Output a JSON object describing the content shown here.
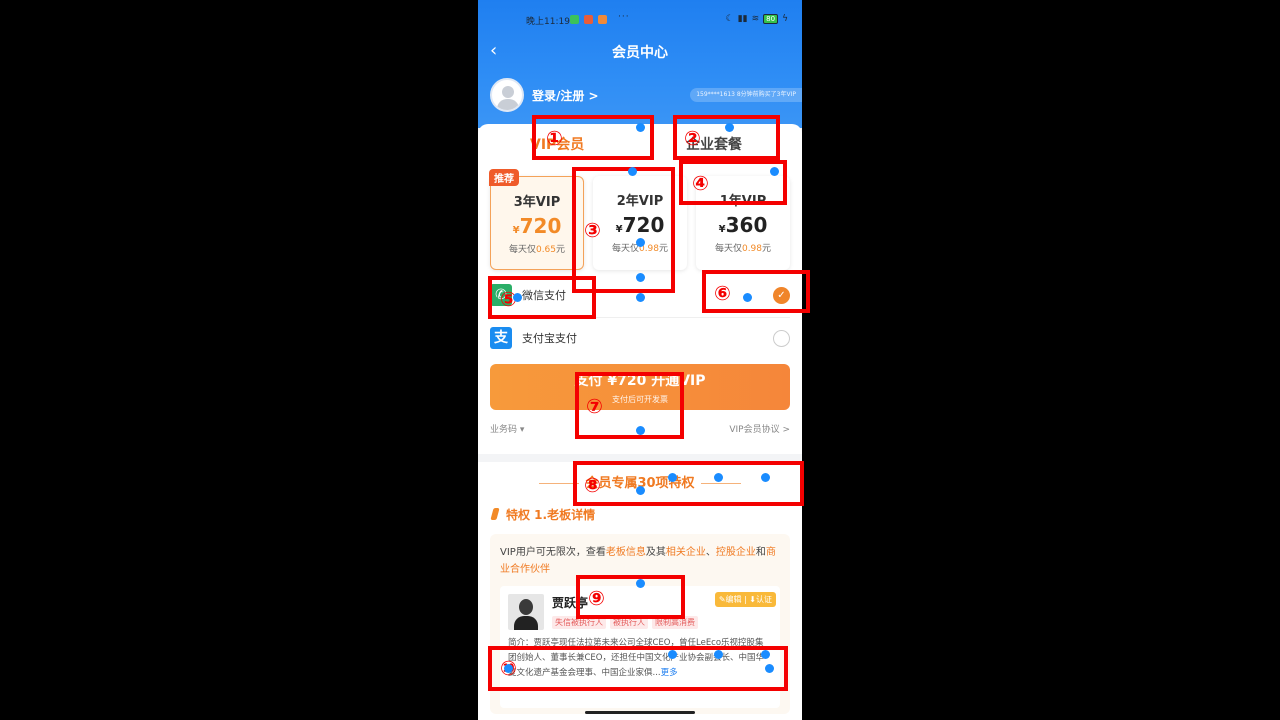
{
  "status_bar": {
    "time": "晚上11:19",
    "dots": "···",
    "battery": "80"
  },
  "nav": {
    "back_icon": "chevron-left-icon",
    "title": "会员中心"
  },
  "user": {
    "login_label": "登录/注册 >",
    "ticker": "159****1613 8分钟前购买了3年VIP"
  },
  "tabs": [
    {
      "label": "VIP会员"
    },
    {
      "label": "企业套餐"
    }
  ],
  "plans": [
    {
      "badge": "推荐",
      "name": "3年VIP",
      "currency": "¥",
      "price": "720",
      "daily_prefix": "每天仅",
      "daily_value": "0.65",
      "daily_suffix": "元"
    },
    {
      "name": "2年VIP",
      "currency": "¥",
      "price": "720",
      "daily_prefix": "每天仅",
      "daily_value": "0.98",
      "daily_suffix": "元"
    },
    {
      "name": "1年VIP",
      "currency": "¥",
      "price": "360",
      "daily_prefix": "每天仅",
      "daily_value": "0.98",
      "daily_suffix": "元"
    }
  ],
  "payment": {
    "wechat": {
      "label": "微信支付",
      "selected_mark": "✓"
    },
    "alipay": {
      "label": "支付宝支付",
      "icon_char": "支"
    }
  },
  "pay_button": {
    "line1": "支付 ¥720 开通VIP",
    "line2": "支付后可开发票"
  },
  "footer_links": {
    "left": "业务码 ▾",
    "right": "VIP会员协议 >"
  },
  "privileges": {
    "title": "会员专属30项特权",
    "item1_title": "特权 1.老板详情",
    "desc_a": "VIP用户可无限次，查看",
    "desc_b": "老板信息",
    "desc_c": "及其",
    "desc_d": "相关企业",
    "desc_e": "、",
    "desc_f": "控股企业",
    "desc_g": "和",
    "desc_h": "商业合作伙伴",
    "person_name": "贾跃亭",
    "edit_badge": "✎编辑 | ⬇认证",
    "tags": [
      "失信被执行人",
      "被执行人",
      "限制高消费"
    ],
    "bio": "简介：贾跃亭现任法拉第未来公司全球CEO，曾任LeEco乐视控股集团创始人、董事长兼CEO，还担任中国文化产业协会副会长、中国华夏文化遗产基金会理事、中国企业家俱...",
    "bio_more": "更多"
  },
  "annotations": [
    "①",
    "②",
    "③",
    "④",
    "⑤",
    "⑥",
    "⑦",
    "⑧",
    "⑨",
    "⑩"
  ],
  "colors": {
    "brand_blue": "#1f7ff0",
    "accent_orange": "#f28a27",
    "annotation_red": "#f40000",
    "marker_blue": "#1a8cff"
  }
}
